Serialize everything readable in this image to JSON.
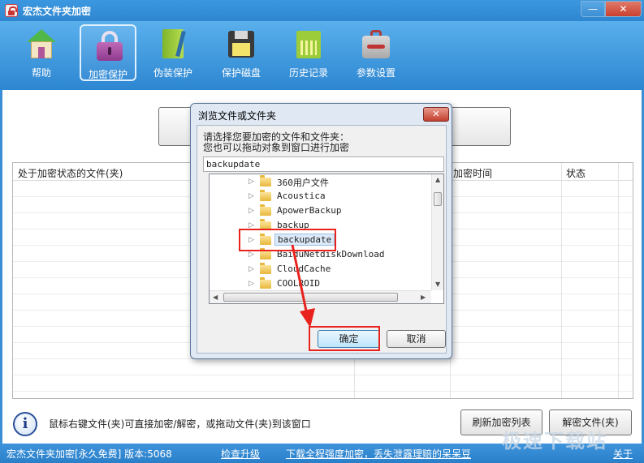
{
  "window": {
    "title": "宏杰文件夹加密",
    "minimize_glyph": "—",
    "close_glyph": "✕"
  },
  "toolbar": {
    "items": [
      {
        "label": "帮助",
        "icon": "home-icon"
      },
      {
        "label": "加密保护",
        "icon": "lock-icon",
        "active": true
      },
      {
        "label": "伪装保护",
        "icon": "book-icon"
      },
      {
        "label": "保护磁盘",
        "icon": "floppy-disk-icon"
      },
      {
        "label": "历史记录",
        "icon": "history-icon"
      },
      {
        "label": "参数设置",
        "icon": "toolbox-icon"
      }
    ]
  },
  "table": {
    "columns": [
      "处于加密状态的文件(夹)",
      "加密时间",
      "状态"
    ]
  },
  "hint": {
    "icon": "info-icon",
    "glyph": "i",
    "text": "鼠标右键文件(夹)可直接加密/解密，或拖动文件(夹)到该窗口"
  },
  "buttons": {
    "refresh": "刷新加密列表",
    "decrypt": "解密文件(夹)"
  },
  "statusbar": {
    "version": "宏杰文件夹加密[永久免费]  版本:5068",
    "check_upgrade": "检查升级",
    "download_link": "下载全程强度加密，丢失泄露理赔的呆呆豆",
    "right_link": "关于"
  },
  "watermark": "极速下载站",
  "dialog": {
    "title": "浏览文件或文件夹",
    "close_glyph": "✕",
    "prompt_line1": "请选择您要加密的文件和文件夹：",
    "prompt_line2": "您也可以拖动对象到窗口进行加密",
    "path_value": "backupdate",
    "folders": [
      {
        "name": "360用户文件"
      },
      {
        "name": "Acoustica"
      },
      {
        "name": "ApowerBackup"
      },
      {
        "name": "backup"
      },
      {
        "name": "backupdate",
        "selected": true
      },
      {
        "name": "BaiduNetdiskDownload"
      },
      {
        "name": "CloudCache"
      },
      {
        "name": "COOLROID"
      }
    ],
    "expand_glyph": "▷",
    "ok_label": "确定",
    "cancel_label": "取消"
  },
  "colors": {
    "accent": "#2f86d0",
    "annotation": "#e8231d"
  }
}
